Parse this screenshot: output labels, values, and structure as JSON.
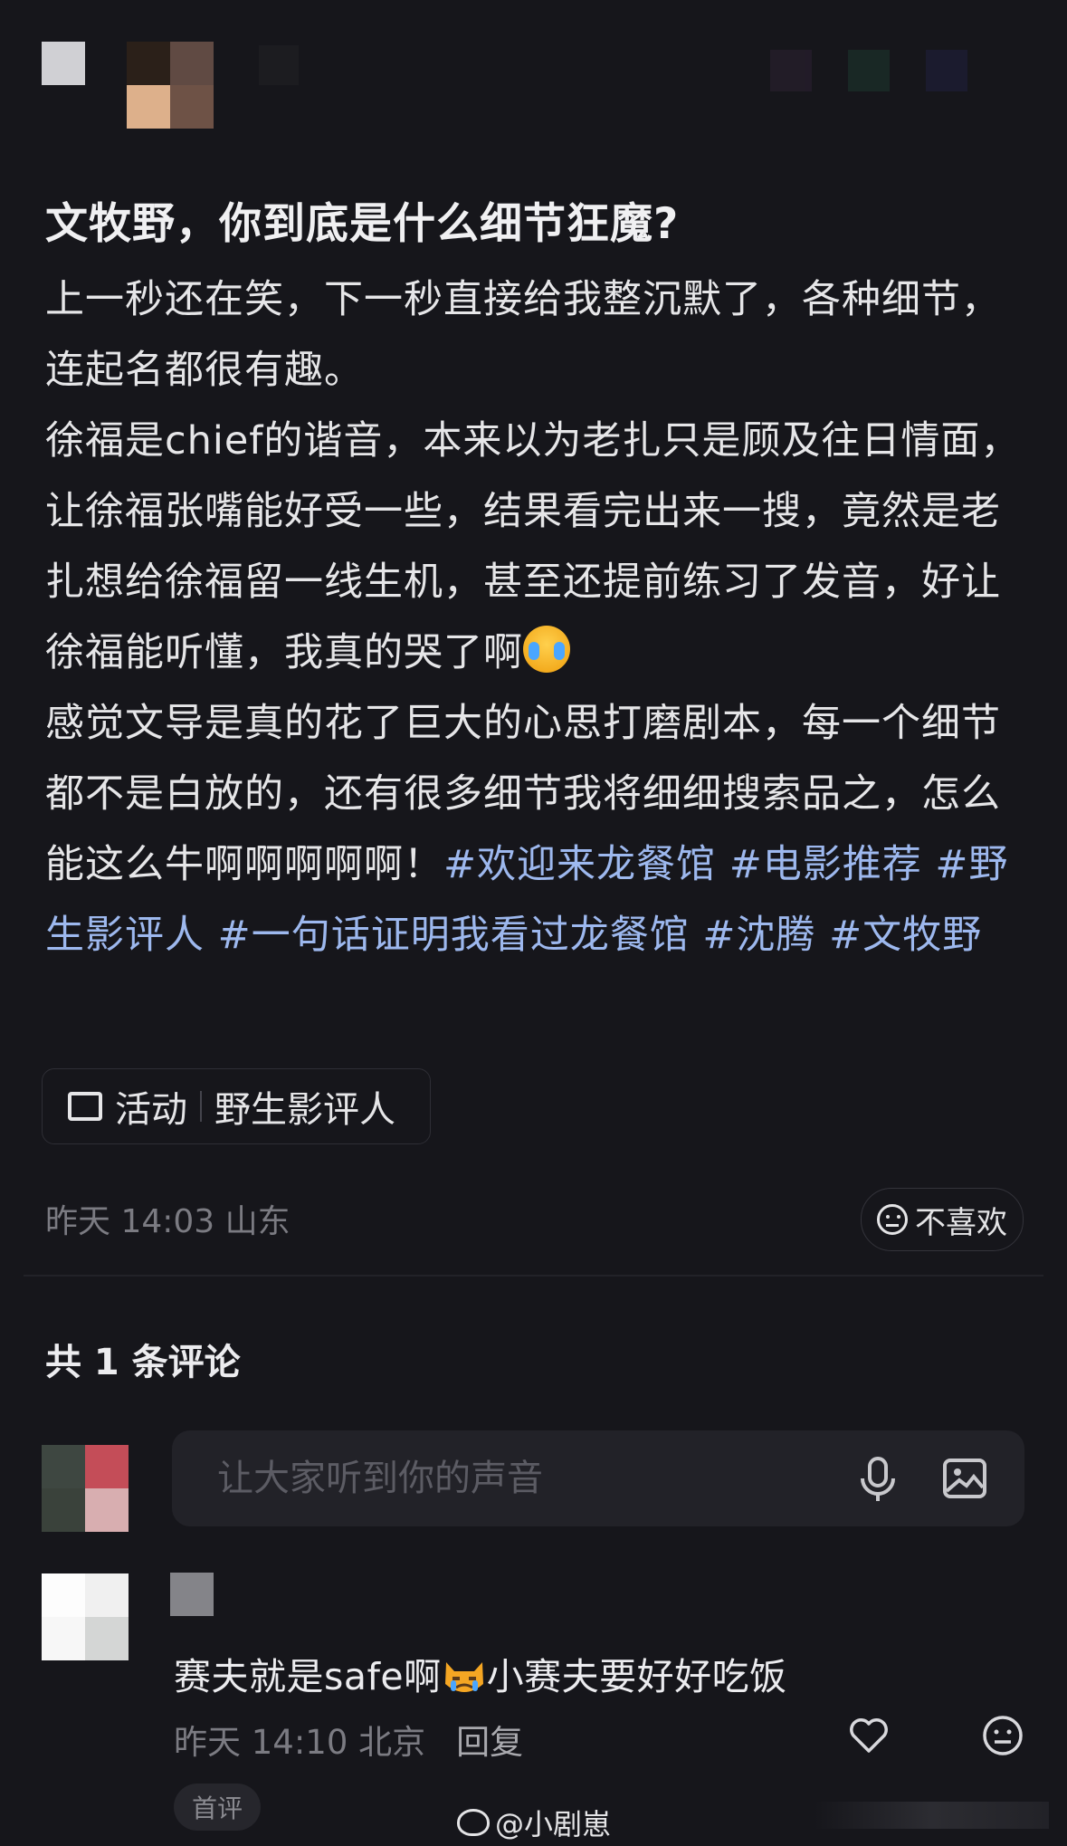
{
  "post": {
    "title": "文牧野，你到底是什么细节狂魔?",
    "paragraph1": "上一秒还在笑，下一秒直接给我整沉默了，各种细节，连起名都很有趣。",
    "paragraph2a": "徐福是chief的谐音，本来以为老扎只是顾及往日情面，让徐福张嘴能好受一些，结果看完出来一搜，竟然是老扎想给徐福留一线生机，甚至还提前练习了发音，好让徐福能听懂，我真的哭了啊",
    "paragraph3": "感觉文导是真的花了巨大的心思打磨剧本，每一个细节都不是白放的，还有很多细节我将细细搜索品之，怎么能这么牛啊啊啊啊啊！",
    "tags": [
      "#欢迎来龙餐馆",
      "#电影推荐",
      "#野生影评人",
      "#一句话证明我看过龙餐馆",
      "#沈腾",
      "#文牧野"
    ],
    "activity_label": "活动",
    "activity_name": "野生影评人",
    "time": "昨天 14:03 山东",
    "dislike_label": "不喜欢"
  },
  "comments": {
    "count_label": "共 1 条评论",
    "input_placeholder": "让大家听到你的声音",
    "items": [
      {
        "text_before_emoji": "赛夫就是safe啊",
        "text_after_emoji": "小赛夫要好好吃饭",
        "time": "昨天 14:10 北京",
        "reply_label": "回复",
        "badge": "首评"
      }
    ]
  },
  "watermark": "@小剧崽",
  "icons": [
    "activity-icon",
    "dislike-face-icon",
    "microphone-icon",
    "image-icon",
    "heart-icon",
    "emoji-face-icon",
    "crying-emoji-icon",
    "cat-emoji-icon",
    "weibo-logo-icon"
  ],
  "colors": {
    "background": "#16161b",
    "tag": "#9db8ee",
    "muted": "#7b7b82",
    "input_bg": "#222228"
  }
}
